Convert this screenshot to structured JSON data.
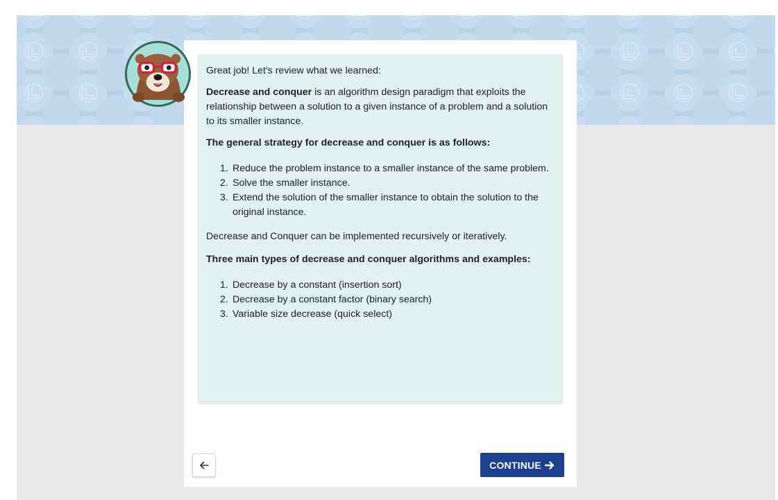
{
  "lesson": {
    "intro": "Great job! Let's review what we learned:",
    "definition_term": "Decrease and conquer",
    "definition_rest": " is an algorithm design paradigm that exploits the relationship between a solution to a given instance of a problem and a solution to its smaller instance.",
    "strategy_heading": "The general strategy for decrease and conquer is as follows:",
    "strategy_steps": [
      {
        "num": "1.",
        "text": "Reduce the problem instance to a smaller instance of the same problem."
      },
      {
        "num": "2.",
        "text": "Solve the smaller instance."
      },
      {
        "num": "3.",
        "text": "Extend the solution of the smaller instance to obtain the solution to the original instance."
      }
    ],
    "implementation_note": "Decrease and Conquer can be implemented recursively or iteratively.",
    "types_heading": "Three main types of decrease and conquer algorithms and examples:",
    "types": [
      {
        "num": "1.",
        "text": "Decrease by a constant (insertion sort)"
      },
      {
        "num": "2.",
        "text": "Decrease by a constant factor (binary search)"
      },
      {
        "num": "3.",
        "text": "Variable size decrease (quick select)"
      }
    ]
  },
  "nav": {
    "back_icon": "arrow-left-icon",
    "continue_label": "CONTINUE",
    "continue_icon": "arrow-right-icon"
  },
  "colors": {
    "banner": "#b6d3ea",
    "note_bg": "#e0f1ef",
    "page_bg": "#e8e7e5",
    "primary_button": "#1d3f8f"
  },
  "mascot": {
    "icon": "otter-with-glasses-icon"
  }
}
